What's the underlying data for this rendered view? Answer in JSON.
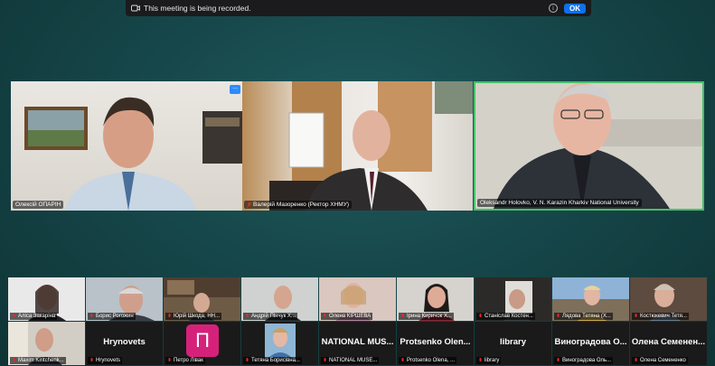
{
  "recording": {
    "message": "This meeting is being recorded.",
    "ok_label": "OK",
    "info_label": "i"
  },
  "speakers": [
    {
      "name": "Олексій ОПАРІН"
    },
    {
      "name": "Валерій Мазоренко (Ректор ХНМУ)"
    },
    {
      "name": "Oleksandr Holovko, V. N. Karazin Kharkiv National University"
    }
  ],
  "more_label": "...",
  "gallery_row1": [
    {
      "name": "Аліса Закаріна"
    },
    {
      "name": "Борис Рогожин"
    },
    {
      "name": "Юрій Шкода, НН..."
    },
    {
      "name": "Андрій Пінчук Х..."
    },
    {
      "name": "Олена КІРШЕВА"
    },
    {
      "name": "Ірина Киричок Х..."
    },
    {
      "name": "Станіслав Костен..."
    },
    {
      "name": "Лядова Тетяна (Х..."
    },
    {
      "name": "Костюкевич Тетя..."
    }
  ],
  "gallery_row2": [
    {
      "name": "Maxim Kiritchenk...",
      "display": ""
    },
    {
      "name": "Hrynovets",
      "display": "Hrynovets"
    },
    {
      "name": "Петро Лівак",
      "display": "П"
    },
    {
      "name": "Тетяна Борисівна...",
      "display": ""
    },
    {
      "name": "NATIONAL MUSE...",
      "display": "NATIONAL MUS..."
    },
    {
      "name": "Protsenko Olena, ...",
      "display": "Protsenko Olen..."
    },
    {
      "name": "library",
      "display": "library"
    },
    {
      "name": "Виноградова Оль...",
      "display": "Виноградова О..."
    },
    {
      "name": "Олена Семененко",
      "display": "Олена Семенен..."
    }
  ],
  "colors": {
    "background": "#16474a",
    "active_speaker_border": "#45c06a",
    "ok_button": "#0e71eb",
    "muted_mic": "#e02d2d"
  }
}
